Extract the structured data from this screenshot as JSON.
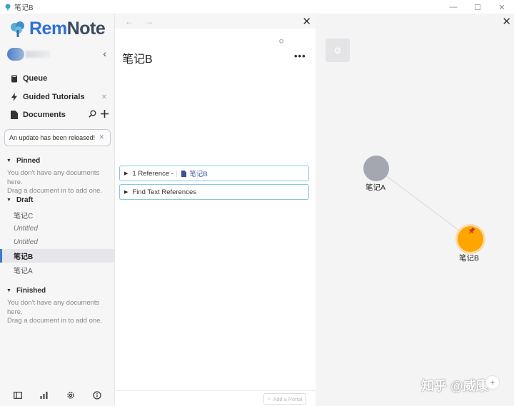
{
  "window": {
    "title": "笔记B",
    "controls": {
      "minimize": "—",
      "maximize": "☐",
      "close": "✕"
    }
  },
  "sidebar": {
    "logo_prefix": "Rem",
    "logo_suffix": "Note",
    "collapse_glyph": "‹",
    "nav": [
      {
        "label": "Queue",
        "icon": "queue-icon"
      },
      {
        "label": "Guided Tutorials",
        "icon": "lightning-icon",
        "close": "✕"
      },
      {
        "label": "Documents",
        "icon": "document-icon"
      }
    ],
    "update_banner": "An update has been released!",
    "update_close": "✕",
    "sections": {
      "pinned": {
        "title": "Pinned",
        "empty_line1": "You don't have any documents here.",
        "empty_line2": "Drag a document in to add one."
      },
      "draft": {
        "title": "Draft",
        "items": [
          "笔记C",
          "Untitled",
          "Untitled",
          "笔记B",
          "笔记A"
        ],
        "active_index": 3
      },
      "finished": {
        "title": "Finished",
        "empty_line1": "You don't have any documents here.",
        "empty_line2": "Drag a document in to add one."
      }
    },
    "bottom_icons": [
      "sidebar-toggle-icon",
      "stats-icon",
      "settings-icon",
      "info-icon"
    ]
  },
  "editor": {
    "back": "←",
    "forward": "→",
    "close": "✕",
    "title": "笔记B",
    "more": "•••",
    "references": {
      "count_label": "1 Reference -",
      "link": "笔记B"
    },
    "find_text_refs": "Find Text References",
    "add_portal_placeholder": "Add a Portal"
  },
  "graph": {
    "close": "✕",
    "nodes": [
      {
        "label": "笔记A",
        "color": "#a4a6b0",
        "pinned": false
      },
      {
        "label": "笔记B",
        "color": "#ffa500",
        "pinned": true
      }
    ],
    "edges": [
      [
        "笔记A",
        "笔记B"
      ]
    ],
    "watermark": "知乎 @威康"
  },
  "colors": {
    "accent": "#3b79d8",
    "node_current": "#ffa500",
    "node_other": "#a4a6b0",
    "reference_border": "#86c9dc"
  }
}
